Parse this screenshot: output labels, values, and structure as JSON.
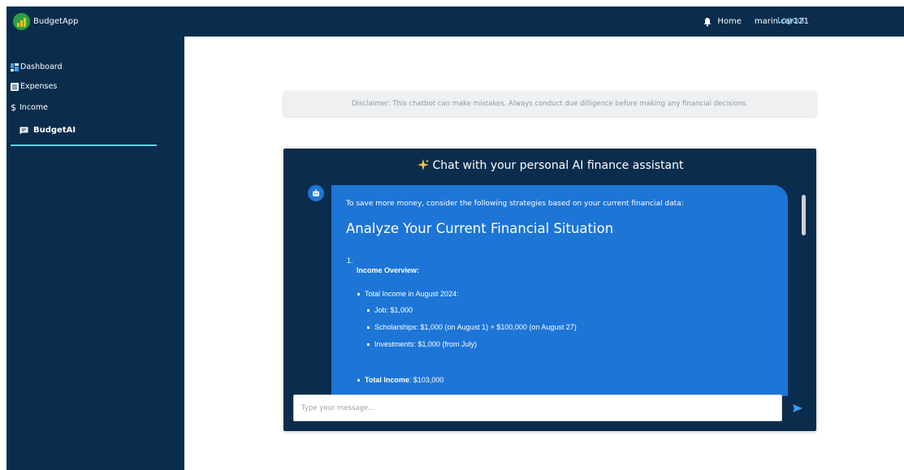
{
  "navbar": {
    "brand": "BudgetApp",
    "home": "Home",
    "user": "marin.car121",
    "logout": "Logout"
  },
  "sidebar": {
    "items": [
      {
        "label": "Dashboard",
        "icon": "dashboard-icon"
      },
      {
        "label": "Expenses",
        "icon": "list-icon"
      },
      {
        "label": "Income",
        "icon": "dollar-icon"
      },
      {
        "label": "BudgetAI",
        "icon": "chat-icon",
        "active": true
      }
    ]
  },
  "disclaimer": "Disclaimer: This chatbot can make mistakes. Always conduct due dilligence before making any financial decisions.",
  "chat": {
    "title": "Chat with your personal AI finance assistant",
    "message": {
      "intro": "To save more money, consider the following strategies based on your current financial data:",
      "heading": "Analyze Your Current Financial Situation",
      "number": "1.",
      "subheading": "Income Overview:",
      "total_line": "Total Income in August 2024:",
      "items": [
        "Job: $1,000",
        "Scholarships: $1,000 (on August 1) + $100,000 (on August 27)",
        "Investments: $1,000 (from July)"
      ],
      "total_label": "Total Income",
      "total_value": ": $103,000"
    },
    "input_placeholder": "Type your message..."
  },
  "colors": {
    "navy": "#0a2d4d",
    "bubble": "#1d75d6",
    "accent_cyan": "#5fd3e0",
    "logout_link": "#7fd0ff"
  }
}
